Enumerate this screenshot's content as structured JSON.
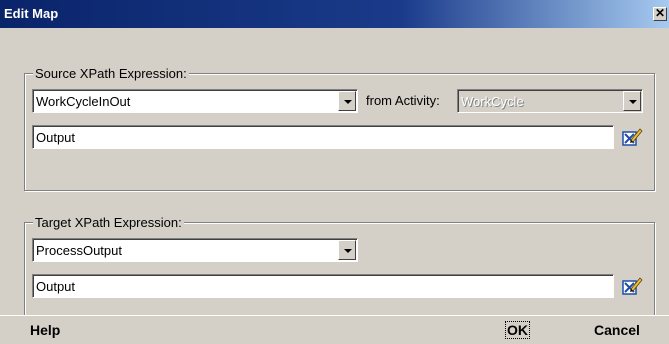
{
  "window": {
    "title": "Edit Map",
    "close_glyph": "✕"
  },
  "source": {
    "legend": "Source XPath Expression:",
    "variable": "WorkCycleInOut",
    "from_activity_label": "from Activity:",
    "activity": "WorkCycle",
    "expression": "Output",
    "edit_icon": "edit-pencil-icon"
  },
  "target": {
    "legend": "Target XPath Expression:",
    "variable": "ProcessOutput",
    "expression": "Output",
    "edit_icon": "edit-pencil-icon"
  },
  "footer": {
    "help_label": "Help",
    "ok_label": "OK",
    "cancel_label": "Cancel"
  },
  "colors": {
    "titlebar": "#0a246a",
    "face": "#d4d0c8",
    "accent": "#1f4ea8"
  }
}
